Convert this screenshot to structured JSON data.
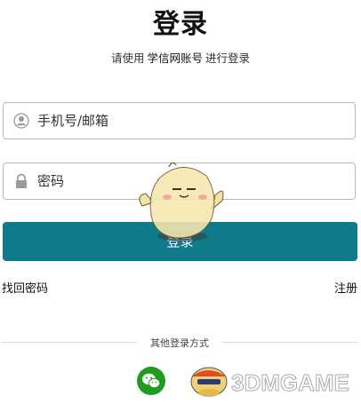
{
  "header": {
    "title": "登录",
    "subtitle_prefix": "请使用",
    "subtitle_brand": "学信网账号",
    "subtitle_suffix": "进行登录"
  },
  "form": {
    "username_placeholder": "手机号/邮箱",
    "password_placeholder": "密码",
    "username_icon": "user-icon",
    "password_icon": "lock-icon",
    "login_label": "登录"
  },
  "links": {
    "forgot": "找回密码",
    "register": "注册"
  },
  "other_login": {
    "label": "其他登录方式",
    "providers": [
      "wechat-icon"
    ]
  },
  "colors": {
    "primary": "#0f7a89",
    "wechat": "#1f9b1f",
    "border": "#b9b9b9"
  },
  "watermark": {
    "text": "3DMGAME"
  }
}
